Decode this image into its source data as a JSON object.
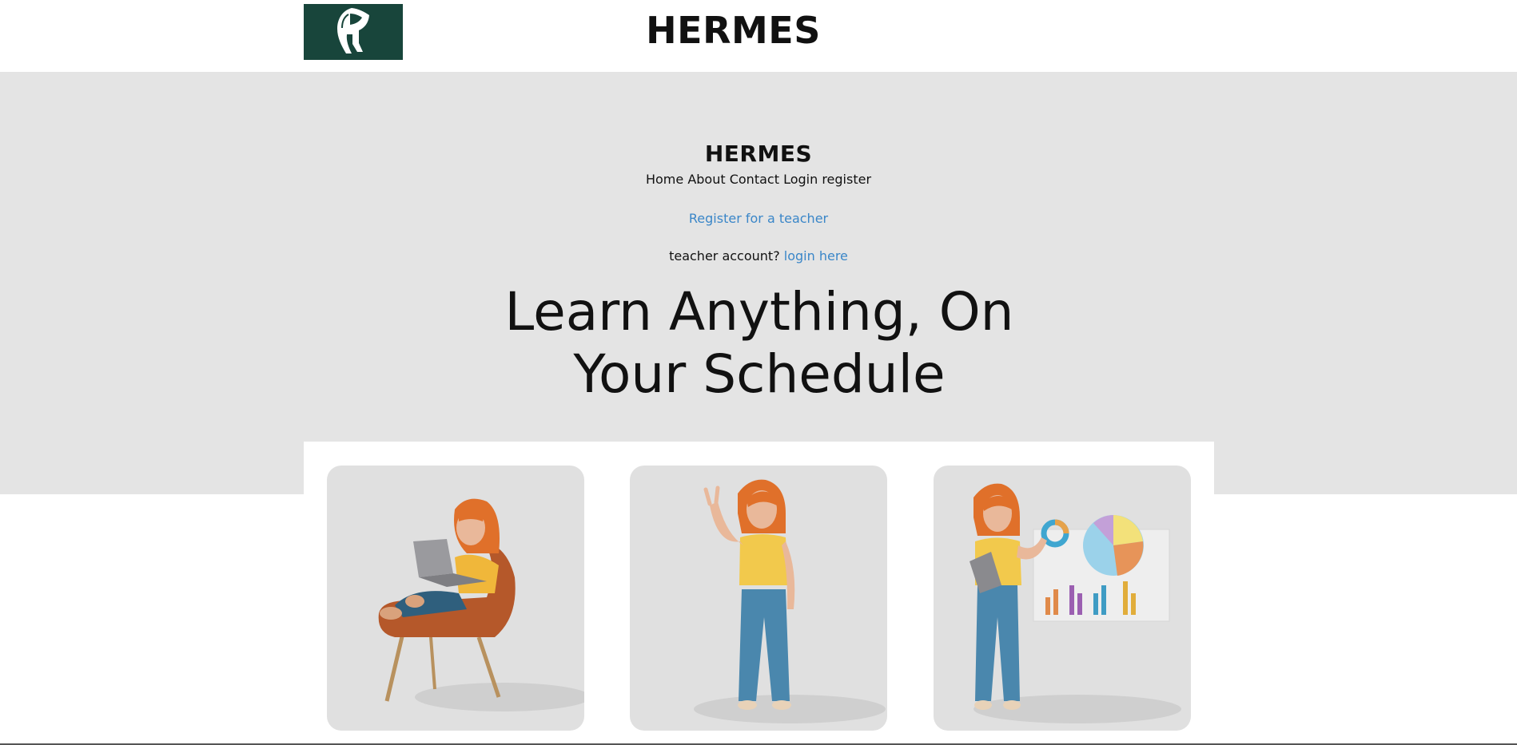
{
  "header": {
    "site_title": "HERMES",
    "logo_icon": "spartan-helmet-icon",
    "logo_color": "#18453b"
  },
  "nav": {
    "brand": "HERMES",
    "links": [
      "Home",
      "About",
      "Contact",
      "Login",
      "register"
    ]
  },
  "teacher": {
    "register_label": "Register for a teacher",
    "login_prompt": "teacher account?",
    "login_link": "login here"
  },
  "hero": {
    "headline_line1": "Learn Anything, On",
    "headline_line2": "Your Schedule"
  },
  "cards": [
    {
      "illustration": "person-with-laptop-in-chair-icon"
    },
    {
      "illustration": "person-waving-icon"
    },
    {
      "illustration": "person-presenting-charts-icon"
    }
  ],
  "colors": {
    "hero_bg": "#e4e4e4",
    "link": "#3a86c8",
    "card_bg": "#e0e0e0"
  }
}
